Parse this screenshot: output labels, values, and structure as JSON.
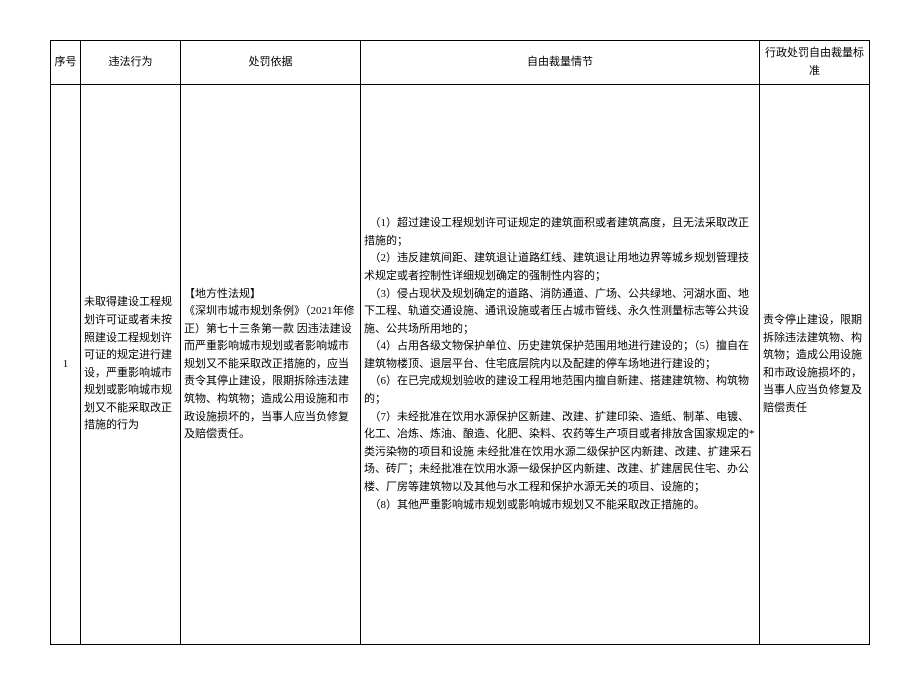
{
  "headers": {
    "seq": "序号",
    "act": "违法行为",
    "basis": "处罚依据",
    "circumstance": "自由裁量情节",
    "standard": "行政处罚自由裁量标准"
  },
  "row": {
    "seq": "1",
    "act": "未取得建设工程规划许可证或者未按照建设工程规划许可证的规定进行建设，严重影响城市规划或影响城市规划又不能采取改正措施的行为",
    "basis": "【地方性法规】\n《深圳市城市规划条例》（2021年修正）第七十三条第一款 因违法建设而严重影响城市规划或者影响城市规划又不能采取改正措施的，应当责令其停止建设，限期拆除违法建筑物、构筑物；造成公用设施和市政设施损坏的，当事人应当负修复及赔偿责任。",
    "circumstance": "　（1）超过建设工程规划许可证规定的建筑面积或者建筑高度，且无法采取改正措施的；\n　（2）违反建筑间距、建筑退让道路红线、建筑退让用地边界等城乡规划管理技术规定或者控制性详细规划确定的强制性内容的；\n　（3）侵占现状及规划确定的道路、消防通道、广场、公共绿地、河湖水面、地下工程、轨道交通设施、通讯设施或者压占城市管线、永久性测量标志等公共设施、公共场所用地的；\n　（4）占用各级文物保护单位、历史建筑保护范围用地进行建设的；（5）擅自在建筑物楼顶、退层平台、住宅底层院内以及配建的停车场地进行建设的；\n　（6）在已完成规划验收的建设工程用地范围内擅自新建、搭建建筑物、构筑物的；\n　（7）未经批准在饮用水源保护区新建、改建、扩建印染、造纸、制革、电镀、化工、冶炼、炼油、酿造、化肥、染料、农药等生产项目或者排放含国家规定的*类污染物的项目和设施 未经批准在饮用水源二级保护区内新建、改建、扩建采石场、砖厂；未经批准在饮用水源一级保护区内新建、改建、扩建居民住宅、办公楼、厂房等建筑物以及其他与水工程和保护水源无关的项目、设施的；\n　（8）其他严重影响城市规划或影响城市规划又不能采取改正措施的。",
    "standard": "责令停止建设，限期拆除违法建筑物、构筑物；造成公用设施和市政设施损坏的，当事人应当负修复及赔偿责任"
  }
}
